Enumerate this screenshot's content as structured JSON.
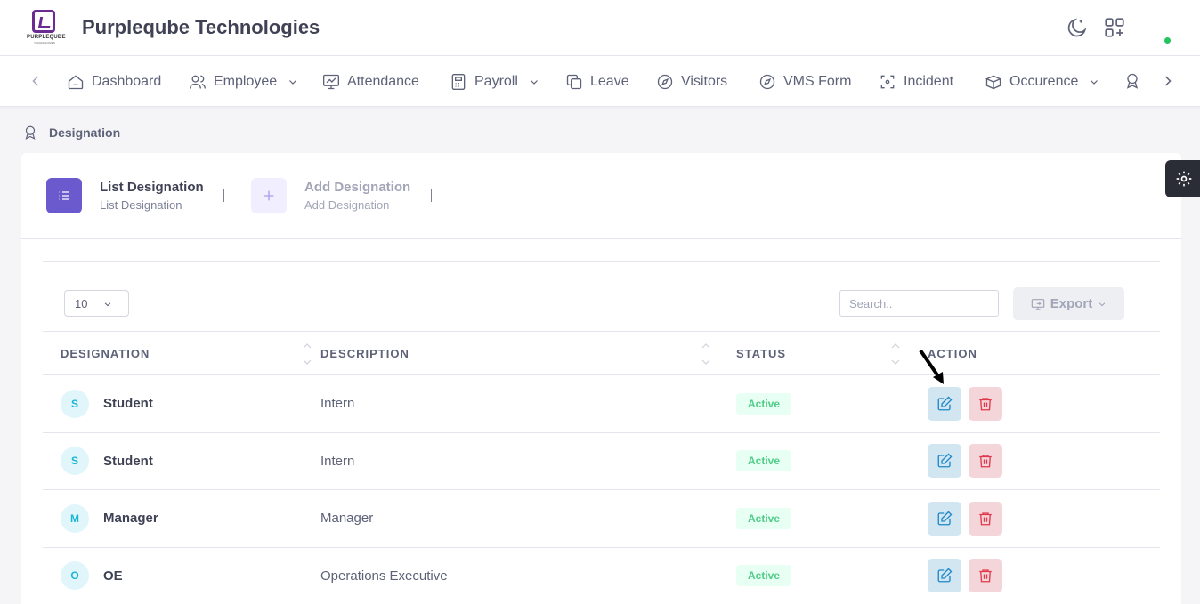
{
  "header": {
    "logo_text": "PURPLEQUBE",
    "logo_sub": "TECHNOLOGIES",
    "company": "Purpleqube Technologies",
    "icons": [
      "moon-icon",
      "apps-add-icon"
    ],
    "status_color": "#22c55e"
  },
  "nav": {
    "items": [
      {
        "label": "Dashboard",
        "icon": "home-icon",
        "dropdown": false
      },
      {
        "label": "Employee",
        "icon": "users-icon",
        "dropdown": true
      },
      {
        "label": "Attendance",
        "icon": "monitor-chart-icon",
        "dropdown": false
      },
      {
        "label": "Payroll",
        "icon": "calculator-icon",
        "dropdown": true
      },
      {
        "label": "Leave",
        "icon": "copy-icon",
        "dropdown": false
      },
      {
        "label": "Visitors",
        "icon": "compass-icon",
        "dropdown": false
      },
      {
        "label": "VMS Form",
        "icon": "compass-icon",
        "dropdown": false
      },
      {
        "label": "Incident",
        "icon": "focus-icon",
        "dropdown": false
      },
      {
        "label": "Occurence",
        "icon": "boxes-icon",
        "dropdown": true
      }
    ]
  },
  "breadcrumb": {
    "label": "Designation"
  },
  "tabs": [
    {
      "title": "List Designation",
      "subtitle": "List Designation",
      "active": true
    },
    {
      "title": "Add Designation",
      "subtitle": "Add Designation",
      "active": false
    }
  ],
  "controls": {
    "page_size": "10",
    "search_placeholder": "Search..",
    "export_label": "Export"
  },
  "table": {
    "columns": [
      "DESIGNATION",
      "DESCRIPTION",
      "STATUS",
      "ACTION"
    ],
    "rows": [
      {
        "initial": "S",
        "designation": "Student",
        "description": "Intern",
        "status": "Active"
      },
      {
        "initial": "S",
        "designation": "Student",
        "description": "Intern",
        "status": "Active"
      },
      {
        "initial": "M",
        "designation": "Manager",
        "description": "Manager",
        "status": "Active"
      },
      {
        "initial": "O",
        "designation": "OE",
        "description": "Operations Executive",
        "status": "Active"
      }
    ]
  },
  "colors": {
    "accent": "#6a5acd",
    "status_active_text": "#50cd89",
    "edit_bg": "#d2e6f1",
    "delete_bg": "#f4d6da"
  }
}
